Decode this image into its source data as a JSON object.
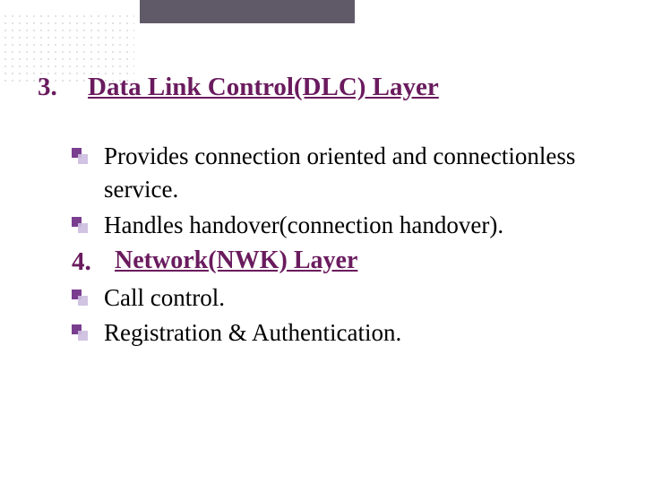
{
  "sections": [
    {
      "number": "3.",
      "title": "Data Link Control(DLC) Layer",
      "items": [
        "Provides connection oriented and connectionless service.",
        "Handles handover(connection handover)."
      ]
    },
    {
      "number": "4.",
      "title": "Network(NWK)  Layer",
      "items": [
        "Call control.",
        "Registration & Authentication."
      ]
    }
  ],
  "colors": {
    "heading": "#6a1b5e",
    "bullet_primary": "#7a3e8f",
    "bullet_secondary": "#cdbfe0",
    "topbar": "#605a68"
  }
}
